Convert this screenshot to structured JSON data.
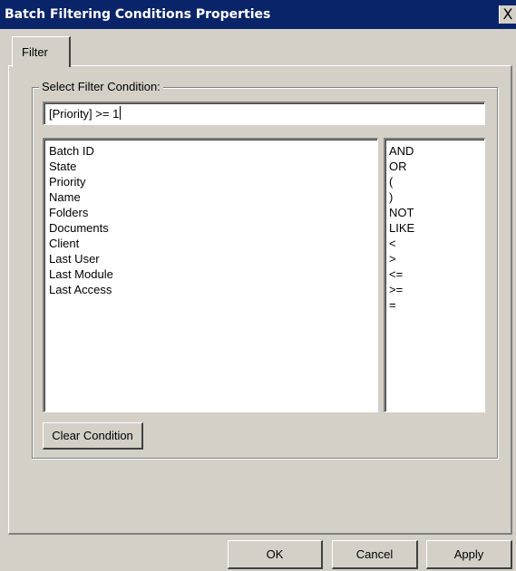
{
  "window": {
    "title": "Batch Filtering Conditions Properties",
    "close_label": "X"
  },
  "tabs": [
    {
      "label": "Filter"
    }
  ],
  "group": {
    "legend": "Select Filter Condition:"
  },
  "filter_input": {
    "value": "[Priority] >= 1"
  },
  "fields": [
    "Batch ID",
    "State",
    "Priority",
    "Name",
    "Folders",
    "Documents",
    "Client",
    "Last User",
    "Last Module",
    "Last Access"
  ],
  "operators": [
    "AND",
    "OR",
    "(",
    ")",
    "NOT",
    "LIKE",
    "<",
    ">",
    "<=",
    ">=",
    "="
  ],
  "buttons": {
    "clear": "Clear Condition",
    "ok": "OK",
    "cancel": "Cancel",
    "apply": "Apply"
  },
  "colors": {
    "titlebar": "#0a246a",
    "dialog": "#d4d0c8"
  }
}
